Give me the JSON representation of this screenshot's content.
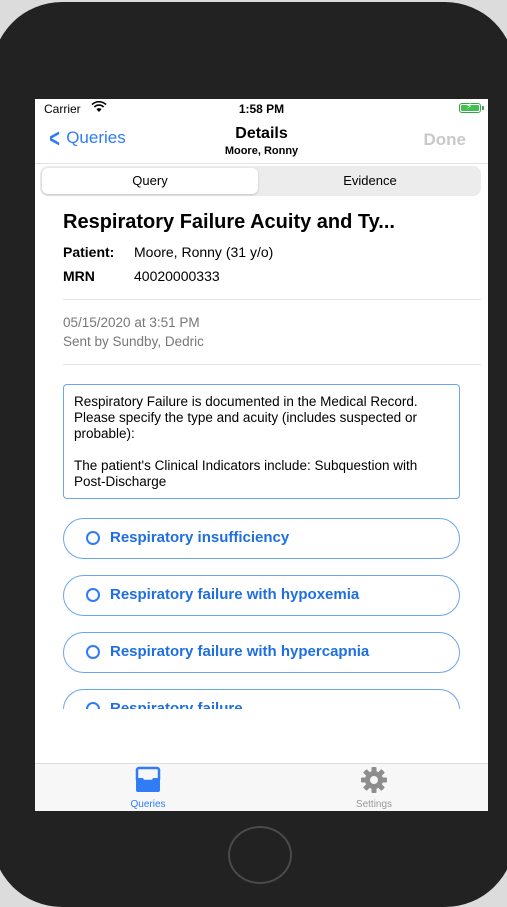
{
  "status_bar": {
    "carrier": "Carrier",
    "time": "1:58 PM"
  },
  "nav": {
    "back_label": "Queries",
    "title": "Details",
    "subtitle": "Moore, Ronny",
    "done_label": "Done"
  },
  "segments": [
    {
      "label": "Query",
      "selected": true
    },
    {
      "label": "Evidence",
      "selected": false
    }
  ],
  "query": {
    "title": "Respiratory Failure Acuity and Ty...",
    "patient_label": "Patient:",
    "patient_value": "Moore, Ronny (31 y/o)",
    "mrn_label": "MRN",
    "mrn_value": "40020000333",
    "sent_at": "05/15/2020 at 3:51 PM",
    "sent_by": "Sent by Sundby, Dedric",
    "question_line1": "Respiratory Failure is documented in the Medical Record. Please specify the type and acuity (includes suspected or probable):",
    "question_line2": "The patient's Clinical Indicators include: Subquestion with Post-Discharge"
  },
  "options": [
    {
      "label": "Respiratory insufficiency"
    },
    {
      "label": "Respiratory failure with hypoxemia"
    },
    {
      "label": "Respiratory failure with hypercapnia"
    },
    {
      "label": "Respiratory failure"
    }
  ],
  "tabs": [
    {
      "label": "Queries",
      "icon": "tray-icon",
      "selected": true
    },
    {
      "label": "Settings",
      "icon": "gear-icon",
      "selected": false
    }
  ],
  "colors": {
    "accent": "#2f7cf6",
    "option_border": "#6aa6ee",
    "battery": "#3fc04f"
  }
}
